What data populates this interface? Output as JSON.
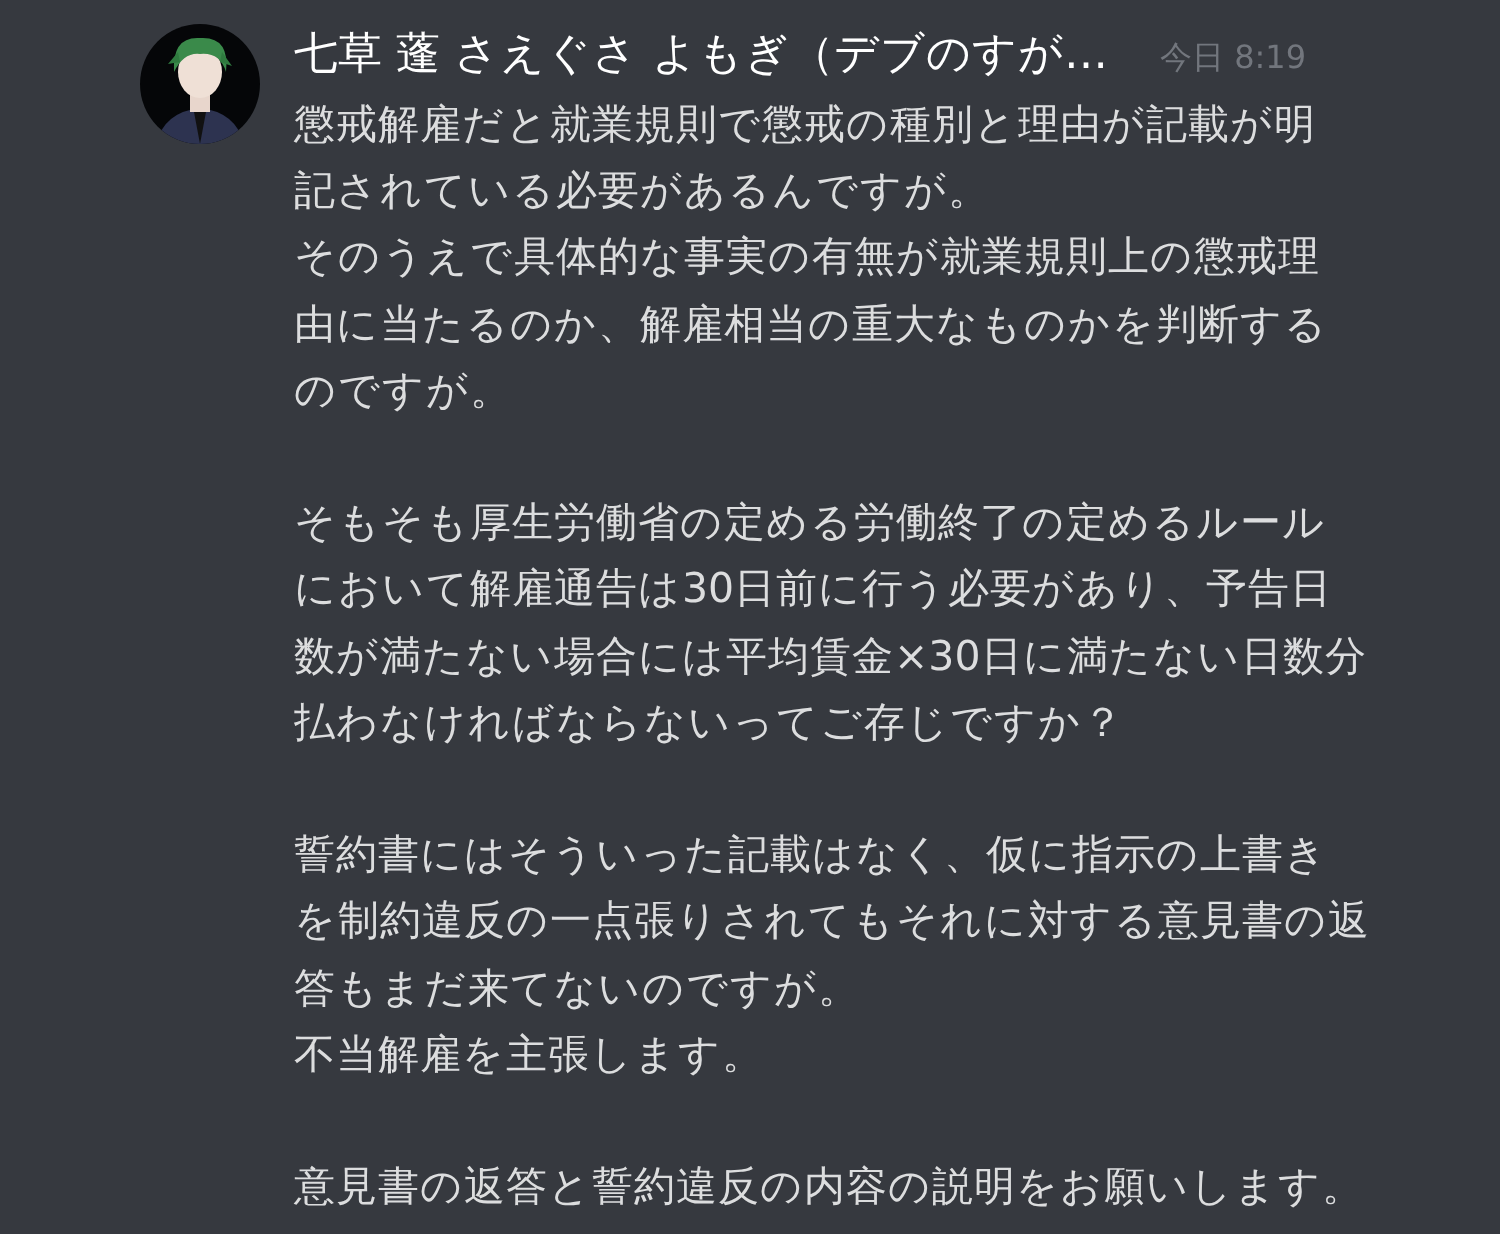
{
  "message": {
    "author": "七草 蓬 さえぐさ よもぎ（デブのすが…",
    "timestamp": "今日 8:19",
    "paragraphs": [
      [
        "懲戒解雇だと就業規則で懲戒の種別と理由が記載が明",
        "記されている必要があるんですが。",
        "そのうえで具体的な事実の有無が就業規則上の懲戒理",
        "由に当たるのか、解雇相当の重大なものかを判断する",
        "のですが。"
      ],
      [
        "そもそも厚生労働省の定める労働終了の定めるルール",
        "において解雇通告は30日前に行う必要があり、予告日",
        "数が満たない場合には平均賃金×30日に満たない日数分",
        "払わなければならないってご存じですか？"
      ],
      [
        "誓約書にはそういった記載はなく、仮に指示の上書き",
        "を制約違反の一点張りされてもそれに対する意見書の返",
        "答もまだ来てないのですが。",
        "不当解雇を主張します。"
      ],
      [
        "意見書の返答と誓約違反の内容の説明をお願いします。"
      ]
    ]
  }
}
